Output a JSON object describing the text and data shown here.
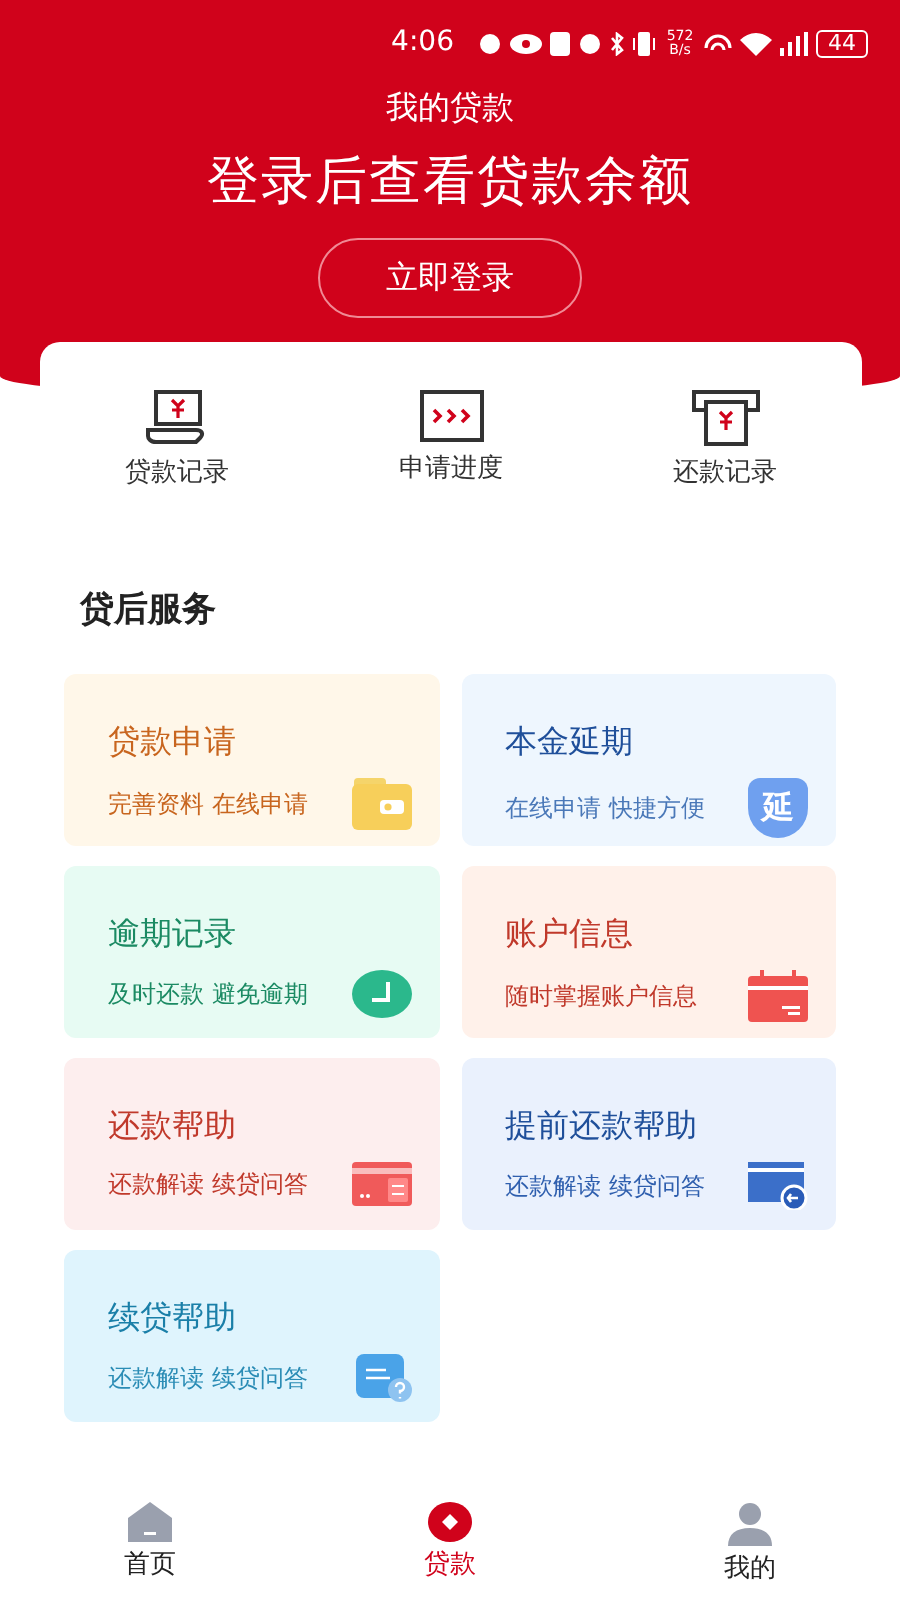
{
  "status_bar": {
    "time": "4:06",
    "speed": "572 B/s",
    "battery": "44"
  },
  "header": {
    "title": "我的贷款",
    "headline": "登录后查看贷款余额",
    "login_button": "立即登录"
  },
  "shortcuts": [
    {
      "kind": "loan-record",
      "label": "贷款记录"
    },
    {
      "kind": "progress",
      "label": "申请进度"
    },
    {
      "kind": "repay-record",
      "label": "还款记录"
    }
  ],
  "section_title": "贷后服务",
  "services": [
    {
      "kind": "wallet",
      "title": "贷款申请",
      "subtitle": "完善资料 在线申请"
    },
    {
      "kind": "shield",
      "title": "本金延期",
      "subtitle": "在线申请 快捷方便",
      "badge": "延"
    },
    {
      "kind": "clock",
      "title": "逾期记录",
      "subtitle": "及时还款  避免逾期"
    },
    {
      "kind": "calendar",
      "title": "账户信息",
      "subtitle": "随时掌握账户信息"
    },
    {
      "kind": "card",
      "title": "还款帮助",
      "subtitle": "还款解读 续贷问答"
    },
    {
      "kind": "card-return",
      "title": "提前还款帮助",
      "subtitle": "还款解读 续贷问答"
    },
    {
      "kind": "help",
      "title": "续贷帮助",
      "subtitle": "还款解读 续贷问答"
    }
  ],
  "nav": [
    {
      "kind": "home",
      "label": "首页",
      "selected": false
    },
    {
      "kind": "loan",
      "label": "贷款",
      "selected": true
    },
    {
      "kind": "me",
      "label": "我的",
      "selected": false
    }
  ]
}
